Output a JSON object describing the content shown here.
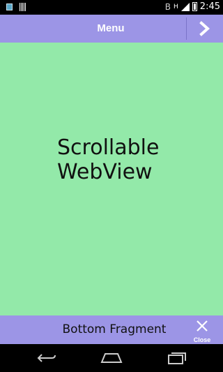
{
  "status_bar": {
    "time": "2:45",
    "network": "H"
  },
  "action_bar": {
    "title": "Menu",
    "next_icon": "chevron-right-icon"
  },
  "content": {
    "text_line1": "Scrollable",
    "text_line2": "WebView"
  },
  "bottom_fragment": {
    "label": "Bottom Fragment",
    "close_label": "Close",
    "close_icon": "close-icon"
  },
  "nav_bar": {
    "back_icon": "back-icon",
    "home_icon": "home-icon",
    "recents_icon": "recents-icon"
  },
  "colors": {
    "bar": "#9c95e6",
    "content_bg": "#93e9a9",
    "status_bg": "#000000"
  }
}
